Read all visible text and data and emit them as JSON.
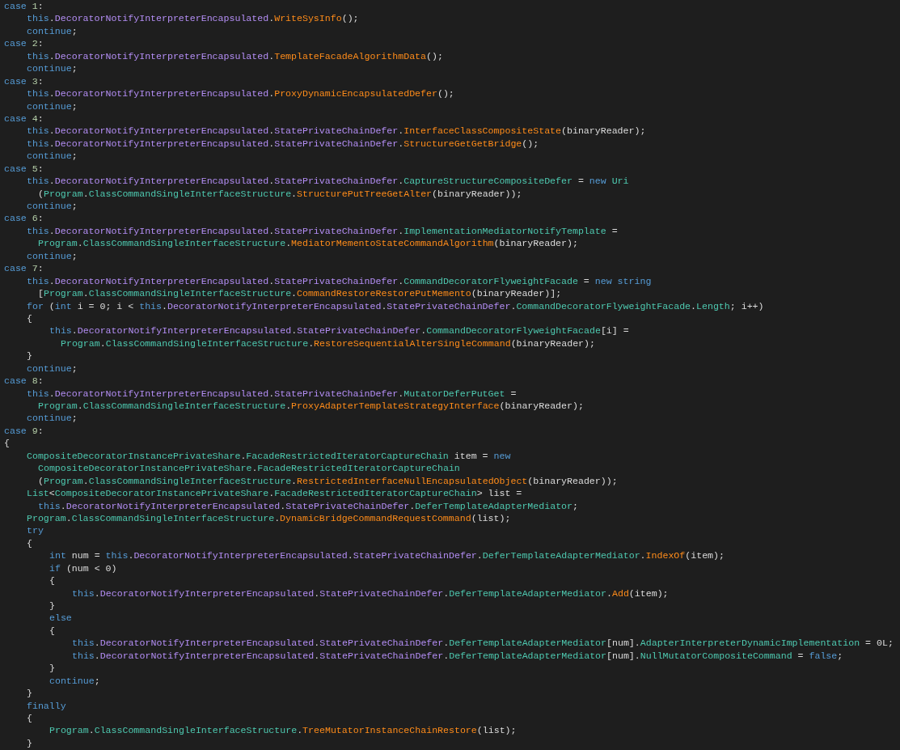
{
  "editor": {
    "lines": [
      {
        "tokens": [
          {
            "kind": "keyword",
            "text": "case "
          },
          {
            "kind": "number",
            "text": "1"
          },
          {
            "kind": "plain",
            "text": ":"
          }
        ],
        "children": [
          {
            "tokens": [
              {
                "kind": "keyword",
                "text": "this"
              },
              {
                "kind": "plain",
                "text": "."
              },
              {
                "kind": "field",
                "text": "DecoratorNotifyInterpreterEncapsulated"
              },
              {
                "kind": "plain",
                "text": "."
              },
              {
                "kind": "method",
                "text": "WriteSysInfo"
              },
              {
                "kind": "plain",
                "text": "();"
              }
            ]
          },
          {
            "tokens": [
              {
                "kind": "keyword",
                "text": "continue"
              },
              {
                "kind": "plain",
                "text": ";"
              }
            ]
          }
        ]
      },
      {
        "tokens": [
          {
            "kind": "keyword",
            "text": "case "
          },
          {
            "kind": "number",
            "text": "2"
          },
          {
            "kind": "plain",
            "text": ":"
          }
        ],
        "children": [
          {
            "tokens": [
              {
                "kind": "keyword",
                "text": "this"
              },
              {
                "kind": "plain",
                "text": "."
              },
              {
                "kind": "field",
                "text": "DecoratorNotifyInterpreterEncapsulated"
              },
              {
                "kind": "plain",
                "text": "."
              },
              {
                "kind": "method",
                "text": "TemplateFacadeAlgorithmData"
              },
              {
                "kind": "plain",
                "text": "();"
              }
            ]
          },
          {
            "tokens": [
              {
                "kind": "keyword",
                "text": "continue"
              },
              {
                "kind": "plain",
                "text": ";"
              }
            ]
          }
        ]
      },
      {
        "tokens": [
          {
            "kind": "keyword",
            "text": "case "
          },
          {
            "kind": "number",
            "text": "3"
          },
          {
            "kind": "plain",
            "text": ":"
          }
        ],
        "children": [
          {
            "tokens": [
              {
                "kind": "keyword",
                "text": "this"
              },
              {
                "kind": "plain",
                "text": "."
              },
              {
                "kind": "field",
                "text": "DecoratorNotifyInterpreterEncapsulated"
              },
              {
                "kind": "plain",
                "text": "."
              },
              {
                "kind": "method",
                "text": "ProxyDynamicEncapsulatedDefer"
              },
              {
                "kind": "plain",
                "text": "();"
              }
            ]
          },
          {
            "tokens": [
              {
                "kind": "keyword",
                "text": "continue"
              },
              {
                "kind": "plain",
                "text": ";"
              }
            ]
          }
        ]
      },
      {
        "tokens": [
          {
            "kind": "keyword",
            "text": "case "
          },
          {
            "kind": "number",
            "text": "4"
          },
          {
            "kind": "plain",
            "text": ":"
          }
        ],
        "children": [
          {
            "tokens": [
              {
                "kind": "keyword",
                "text": "this"
              },
              {
                "kind": "plain",
                "text": "."
              },
              {
                "kind": "field",
                "text": "DecoratorNotifyInterpreterEncapsulated"
              },
              {
                "kind": "plain",
                "text": "."
              },
              {
                "kind": "field",
                "text": "StatePrivateChainDefer"
              },
              {
                "kind": "plain",
                "text": "."
              },
              {
                "kind": "method",
                "text": "InterfaceClassCompositeState"
              },
              {
                "kind": "plain",
                "text": "(binaryReader);"
              }
            ]
          },
          {
            "tokens": [
              {
                "kind": "keyword",
                "text": "this"
              },
              {
                "kind": "plain",
                "text": "."
              },
              {
                "kind": "field",
                "text": "DecoratorNotifyInterpreterEncapsulated"
              },
              {
                "kind": "plain",
                "text": "."
              },
              {
                "kind": "field",
                "text": "StatePrivateChainDefer"
              },
              {
                "kind": "plain",
                "text": "."
              },
              {
                "kind": "method",
                "text": "StructureGetGetBridge"
              },
              {
                "kind": "plain",
                "text": "();"
              }
            ]
          },
          {
            "tokens": [
              {
                "kind": "keyword",
                "text": "continue"
              },
              {
                "kind": "plain",
                "text": ";"
              }
            ]
          }
        ]
      },
      {
        "tokens": [
          {
            "kind": "keyword",
            "text": "case "
          },
          {
            "kind": "number",
            "text": "5"
          },
          {
            "kind": "plain",
            "text": ":"
          }
        ],
        "children": [
          {
            "tokens": [
              {
                "kind": "keyword",
                "text": "this"
              },
              {
                "kind": "plain",
                "text": "."
              },
              {
                "kind": "field",
                "text": "DecoratorNotifyInterpreterEncapsulated"
              },
              {
                "kind": "plain",
                "text": "."
              },
              {
                "kind": "field",
                "text": "StatePrivateChainDefer"
              },
              {
                "kind": "plain",
                "text": "."
              },
              {
                "kind": "type",
                "text": "CaptureStructureCompositeDefer"
              },
              {
                "kind": "plain",
                "text": " = "
              },
              {
                "kind": "keyword",
                "text": "new "
              },
              {
                "kind": "type",
                "text": "Uri"
              }
            ],
            "continuation": [
              {
                "tokens": [
                  {
                    "kind": "plain",
                    "text": "("
                  },
                  {
                    "kind": "type",
                    "text": "Program"
                  },
                  {
                    "kind": "plain",
                    "text": "."
                  },
                  {
                    "kind": "type",
                    "text": "ClassCommandSingleInterfaceStructure"
                  },
                  {
                    "kind": "plain",
                    "text": "."
                  },
                  {
                    "kind": "method",
                    "text": "StructurePutTreeGetAlter"
                  },
                  {
                    "kind": "plain",
                    "text": "(binaryReader));"
                  }
                ]
              }
            ]
          },
          {
            "tokens": [
              {
                "kind": "keyword",
                "text": "continue"
              },
              {
                "kind": "plain",
                "text": ";"
              }
            ]
          }
        ]
      },
      {
        "tokens": [
          {
            "kind": "keyword",
            "text": "case "
          },
          {
            "kind": "number",
            "text": "6"
          },
          {
            "kind": "plain",
            "text": ":"
          }
        ],
        "children": [
          {
            "tokens": [
              {
                "kind": "keyword",
                "text": "this"
              },
              {
                "kind": "plain",
                "text": "."
              },
              {
                "kind": "field",
                "text": "DecoratorNotifyInterpreterEncapsulated"
              },
              {
                "kind": "plain",
                "text": "."
              },
              {
                "kind": "field",
                "text": "StatePrivateChainDefer"
              },
              {
                "kind": "plain",
                "text": "."
              },
              {
                "kind": "type",
                "text": "ImplementationMediatorNotifyTemplate"
              },
              {
                "kind": "plain",
                "text": " ="
              }
            ],
            "continuation": [
              {
                "tokens": [
                  {
                    "kind": "type",
                    "text": "Program"
                  },
                  {
                    "kind": "plain",
                    "text": "."
                  },
                  {
                    "kind": "type",
                    "text": "ClassCommandSingleInterfaceStructure"
                  },
                  {
                    "kind": "plain",
                    "text": "."
                  },
                  {
                    "kind": "method",
                    "text": "MediatorMementoStateCommandAlgorithm"
                  },
                  {
                    "kind": "plain",
                    "text": "(binaryReader);"
                  }
                ]
              }
            ]
          },
          {
            "tokens": [
              {
                "kind": "keyword",
                "text": "continue"
              },
              {
                "kind": "plain",
                "text": ";"
              }
            ]
          }
        ]
      },
      {
        "tokens": [
          {
            "kind": "keyword",
            "text": "case "
          },
          {
            "kind": "number",
            "text": "7"
          },
          {
            "kind": "plain",
            "text": ":"
          }
        ],
        "children": [
          {
            "tokens": [
              {
                "kind": "keyword",
                "text": "this"
              },
              {
                "kind": "plain",
                "text": "."
              },
              {
                "kind": "field",
                "text": "DecoratorNotifyInterpreterEncapsulated"
              },
              {
                "kind": "plain",
                "text": "."
              },
              {
                "kind": "field",
                "text": "StatePrivateChainDefer"
              },
              {
                "kind": "plain",
                "text": "."
              },
              {
                "kind": "type",
                "text": "CommandDecoratorFlyweightFacade"
              },
              {
                "kind": "plain",
                "text": " = "
              },
              {
                "kind": "keyword",
                "text": "new string"
              }
            ],
            "continuation": [
              {
                "tokens": [
                  {
                    "kind": "plain",
                    "text": "["
                  },
                  {
                    "kind": "type",
                    "text": "Program"
                  },
                  {
                    "kind": "plain",
                    "text": "."
                  },
                  {
                    "kind": "type",
                    "text": "ClassCommandSingleInterfaceStructure"
                  },
                  {
                    "kind": "plain",
                    "text": "."
                  },
                  {
                    "kind": "method",
                    "text": "CommandRestoreRestorePutMemento"
                  },
                  {
                    "kind": "plain",
                    "text": "(binaryReader)];"
                  }
                ]
              }
            ]
          },
          {
            "tokens": [
              {
                "kind": "keyword",
                "text": "for"
              },
              {
                "kind": "plain",
                "text": " ("
              },
              {
                "kind": "keyword",
                "text": "int"
              },
              {
                "kind": "plain",
                "text": " i = 0; i < "
              },
              {
                "kind": "keyword",
                "text": "this"
              },
              {
                "kind": "plain",
                "text": "."
              },
              {
                "kind": "field",
                "text": "DecoratorNotifyInterpreterEncapsulated"
              },
              {
                "kind": "plain",
                "text": "."
              },
              {
                "kind": "field",
                "text": "StatePrivateChainDefer"
              },
              {
                "kind": "plain",
                "text": "."
              },
              {
                "kind": "type",
                "text": "CommandDecoratorFlyweightFacade"
              },
              {
                "kind": "plain",
                "text": "."
              },
              {
                "kind": "type",
                "text": "Length"
              },
              {
                "kind": "plain",
                "text": "; i++)"
              }
            ]
          },
          {
            "tokens": [
              {
                "kind": "plain",
                "text": "{"
              }
            ],
            "children": [
              {
                "tokens": [
                  {
                    "kind": "keyword",
                    "text": "this"
                  },
                  {
                    "kind": "plain",
                    "text": "."
                  },
                  {
                    "kind": "field",
                    "text": "DecoratorNotifyInterpreterEncapsulated"
                  },
                  {
                    "kind": "plain",
                    "text": "."
                  },
                  {
                    "kind": "field",
                    "text": "StatePrivateChainDefer"
                  },
                  {
                    "kind": "plain",
                    "text": "."
                  },
                  {
                    "kind": "type",
                    "text": "CommandDecoratorFlyweightFacade"
                  },
                  {
                    "kind": "plain",
                    "text": "[i] ="
                  }
                ],
                "continuation": [
                  {
                    "tokens": [
                      {
                        "kind": "type",
                        "text": "Program"
                      },
                      {
                        "kind": "plain",
                        "text": "."
                      },
                      {
                        "kind": "type",
                        "text": "ClassCommandSingleInterfaceStructure"
                      },
                      {
                        "kind": "plain",
                        "text": "."
                      },
                      {
                        "kind": "method",
                        "text": "RestoreSequentialAlterSingleCommand"
                      },
                      {
                        "kind": "plain",
                        "text": "(binaryReader);"
                      }
                    ]
                  }
                ]
              }
            ]
          },
          {
            "tokens": [
              {
                "kind": "plain",
                "text": "}"
              }
            ]
          },
          {
            "tokens": [
              {
                "kind": "keyword",
                "text": "continue"
              },
              {
                "kind": "plain",
                "text": ";"
              }
            ]
          }
        ]
      },
      {
        "tokens": [
          {
            "kind": "keyword",
            "text": "case "
          },
          {
            "kind": "number",
            "text": "8"
          },
          {
            "kind": "plain",
            "text": ":"
          }
        ],
        "children": [
          {
            "tokens": [
              {
                "kind": "keyword",
                "text": "this"
              },
              {
                "kind": "plain",
                "text": "."
              },
              {
                "kind": "field",
                "text": "DecoratorNotifyInterpreterEncapsulated"
              },
              {
                "kind": "plain",
                "text": "."
              },
              {
                "kind": "field",
                "text": "StatePrivateChainDefer"
              },
              {
                "kind": "plain",
                "text": "."
              },
              {
                "kind": "type",
                "text": "MutatorDeferPutGet"
              },
              {
                "kind": "plain",
                "text": " ="
              }
            ],
            "continuation": [
              {
                "tokens": [
                  {
                    "kind": "type",
                    "text": "Program"
                  },
                  {
                    "kind": "plain",
                    "text": "."
                  },
                  {
                    "kind": "type",
                    "text": "ClassCommandSingleInterfaceStructure"
                  },
                  {
                    "kind": "plain",
                    "text": "."
                  },
                  {
                    "kind": "method",
                    "text": "ProxyAdapterTemplateStrategyInterface"
                  },
                  {
                    "kind": "plain",
                    "text": "(binaryReader);"
                  }
                ]
              }
            ]
          },
          {
            "tokens": [
              {
                "kind": "keyword",
                "text": "continue"
              },
              {
                "kind": "plain",
                "text": ";"
              }
            ]
          }
        ]
      },
      {
        "tokens": [
          {
            "kind": "keyword",
            "text": "case "
          },
          {
            "kind": "number",
            "text": "9"
          },
          {
            "kind": "plain",
            "text": ":"
          }
        ]
      },
      {
        "tokens": [
          {
            "kind": "plain",
            "text": "{"
          }
        ],
        "children": [
          {
            "tokens": [
              {
                "kind": "type",
                "text": "CompositeDecoratorInstancePrivateShare"
              },
              {
                "kind": "plain",
                "text": "."
              },
              {
                "kind": "type",
                "text": "FacadeRestrictedIteratorCaptureChain"
              },
              {
                "kind": "plain",
                "text": " item = "
              },
              {
                "kind": "keyword",
                "text": "new"
              }
            ],
            "continuation": [
              {
                "tokens": [
                  {
                    "kind": "type",
                    "text": "CompositeDecoratorInstancePrivateShare"
                  },
                  {
                    "kind": "plain",
                    "text": "."
                  },
                  {
                    "kind": "type",
                    "text": "FacadeRestrictedIteratorCaptureChain"
                  }
                ]
              },
              {
                "tokens": [
                  {
                    "kind": "plain",
                    "text": "("
                  },
                  {
                    "kind": "type",
                    "text": "Program"
                  },
                  {
                    "kind": "plain",
                    "text": "."
                  },
                  {
                    "kind": "type",
                    "text": "ClassCommandSingleInterfaceStructure"
                  },
                  {
                    "kind": "plain",
                    "text": "."
                  },
                  {
                    "kind": "method",
                    "text": "RestrictedInterfaceNullEncapsulatedObject"
                  },
                  {
                    "kind": "plain",
                    "text": "(binaryReader));"
                  }
                ]
              }
            ]
          },
          {
            "tokens": [
              {
                "kind": "type",
                "text": "List"
              },
              {
                "kind": "plain",
                "text": "<"
              },
              {
                "kind": "type",
                "text": "CompositeDecoratorInstancePrivateShare"
              },
              {
                "kind": "plain",
                "text": "."
              },
              {
                "kind": "type",
                "text": "FacadeRestrictedIteratorCaptureChain"
              },
              {
                "kind": "plain",
                "text": "> list ="
              }
            ],
            "continuation": [
              {
                "tokens": [
                  {
                    "kind": "keyword",
                    "text": "this"
                  },
                  {
                    "kind": "plain",
                    "text": "."
                  },
                  {
                    "kind": "field",
                    "text": "DecoratorNotifyInterpreterEncapsulated"
                  },
                  {
                    "kind": "plain",
                    "text": "."
                  },
                  {
                    "kind": "field",
                    "text": "StatePrivateChainDefer"
                  },
                  {
                    "kind": "plain",
                    "text": "."
                  },
                  {
                    "kind": "type",
                    "text": "DeferTemplateAdapterMediator"
                  },
                  {
                    "kind": "plain",
                    "text": ";"
                  }
                ]
              }
            ]
          },
          {
            "tokens": [
              {
                "kind": "type",
                "text": "Program"
              },
              {
                "kind": "plain",
                "text": "."
              },
              {
                "kind": "type",
                "text": "ClassCommandSingleInterfaceStructure"
              },
              {
                "kind": "plain",
                "text": "."
              },
              {
                "kind": "method",
                "text": "DynamicBridgeCommandRequestCommand"
              },
              {
                "kind": "plain",
                "text": "(list);"
              }
            ]
          },
          {
            "tokens": [
              {
                "kind": "keyword",
                "text": "try"
              }
            ]
          },
          {
            "tokens": [
              {
                "kind": "plain",
                "text": "{"
              }
            ],
            "children": [
              {
                "tokens": [
                  {
                    "kind": "keyword",
                    "text": "int"
                  },
                  {
                    "kind": "plain",
                    "text": " num = "
                  },
                  {
                    "kind": "keyword",
                    "text": "this"
                  },
                  {
                    "kind": "plain",
                    "text": "."
                  },
                  {
                    "kind": "field",
                    "text": "DecoratorNotifyInterpreterEncapsulated"
                  },
                  {
                    "kind": "plain",
                    "text": "."
                  },
                  {
                    "kind": "field",
                    "text": "StatePrivateChainDefer"
                  },
                  {
                    "kind": "plain",
                    "text": "."
                  },
                  {
                    "kind": "type",
                    "text": "DeferTemplateAdapterMediator"
                  },
                  {
                    "kind": "plain",
                    "text": "."
                  },
                  {
                    "kind": "method",
                    "text": "IndexOf"
                  },
                  {
                    "kind": "plain",
                    "text": "(item);"
                  }
                ]
              },
              {
                "tokens": [
                  {
                    "kind": "keyword",
                    "text": "if"
                  },
                  {
                    "kind": "plain",
                    "text": " (num < 0)"
                  }
                ]
              },
              {
                "tokens": [
                  {
                    "kind": "plain",
                    "text": "{"
                  }
                ],
                "children": [
                  {
                    "tokens": [
                      {
                        "kind": "keyword",
                        "text": "this"
                      },
                      {
                        "kind": "plain",
                        "text": "."
                      },
                      {
                        "kind": "field",
                        "text": "DecoratorNotifyInterpreterEncapsulated"
                      },
                      {
                        "kind": "plain",
                        "text": "."
                      },
                      {
                        "kind": "field",
                        "text": "StatePrivateChainDefer"
                      },
                      {
                        "kind": "plain",
                        "text": "."
                      },
                      {
                        "kind": "type",
                        "text": "DeferTemplateAdapterMediator"
                      },
                      {
                        "kind": "plain",
                        "text": "."
                      },
                      {
                        "kind": "method",
                        "text": "Add"
                      },
                      {
                        "kind": "plain",
                        "text": "(item);"
                      }
                    ]
                  }
                ]
              },
              {
                "tokens": [
                  {
                    "kind": "plain",
                    "text": "}"
                  }
                ]
              },
              {
                "tokens": [
                  {
                    "kind": "keyword",
                    "text": "else"
                  }
                ]
              },
              {
                "tokens": [
                  {
                    "kind": "plain",
                    "text": "{"
                  }
                ],
                "children": [
                  {
                    "tokens": [
                      {
                        "kind": "keyword",
                        "text": "this"
                      },
                      {
                        "kind": "plain",
                        "text": "."
                      },
                      {
                        "kind": "field",
                        "text": "DecoratorNotifyInterpreterEncapsulated"
                      },
                      {
                        "kind": "plain",
                        "text": "."
                      },
                      {
                        "kind": "field",
                        "text": "StatePrivateChainDefer"
                      },
                      {
                        "kind": "plain",
                        "text": "."
                      },
                      {
                        "kind": "type",
                        "text": "DeferTemplateAdapterMediator"
                      },
                      {
                        "kind": "plain",
                        "text": "[num]."
                      },
                      {
                        "kind": "type",
                        "text": "AdapterInterpreterDynamicImplementation"
                      },
                      {
                        "kind": "plain",
                        "text": " = 0L;"
                      }
                    ]
                  },
                  {
                    "tokens": [
                      {
                        "kind": "keyword",
                        "text": "this"
                      },
                      {
                        "kind": "plain",
                        "text": "."
                      },
                      {
                        "kind": "field",
                        "text": "DecoratorNotifyInterpreterEncapsulated"
                      },
                      {
                        "kind": "plain",
                        "text": "."
                      },
                      {
                        "kind": "field",
                        "text": "StatePrivateChainDefer"
                      },
                      {
                        "kind": "plain",
                        "text": "."
                      },
                      {
                        "kind": "type",
                        "text": "DeferTemplateAdapterMediator"
                      },
                      {
                        "kind": "plain",
                        "text": "[num]."
                      },
                      {
                        "kind": "type",
                        "text": "NullMutatorCompositeCommand"
                      },
                      {
                        "kind": "plain",
                        "text": " = "
                      },
                      {
                        "kind": "keyword",
                        "text": "false"
                      },
                      {
                        "kind": "plain",
                        "text": ";"
                      }
                    ]
                  }
                ]
              },
              {
                "tokens": [
                  {
                    "kind": "plain",
                    "text": "}"
                  }
                ]
              },
              {
                "tokens": [
                  {
                    "kind": "keyword",
                    "text": "continue"
                  },
                  {
                    "kind": "plain",
                    "text": ";"
                  }
                ]
              }
            ]
          },
          {
            "tokens": [
              {
                "kind": "plain",
                "text": "}"
              }
            ]
          },
          {
            "tokens": [
              {
                "kind": "keyword",
                "text": "finally"
              }
            ]
          },
          {
            "tokens": [
              {
                "kind": "plain",
                "text": "{"
              }
            ],
            "children": [
              {
                "tokens": [
                  {
                    "kind": "type",
                    "text": "Program"
                  },
                  {
                    "kind": "plain",
                    "text": "."
                  },
                  {
                    "kind": "type",
                    "text": "ClassCommandSingleInterfaceStructure"
                  },
                  {
                    "kind": "plain",
                    "text": "."
                  },
                  {
                    "kind": "method",
                    "text": "TreeMutatorInstanceChainRestore"
                  },
                  {
                    "kind": "plain",
                    "text": "(list);"
                  }
                ]
              }
            ]
          },
          {
            "tokens": [
              {
                "kind": "plain",
                "text": "}"
              }
            ]
          }
        ]
      }
    ]
  }
}
